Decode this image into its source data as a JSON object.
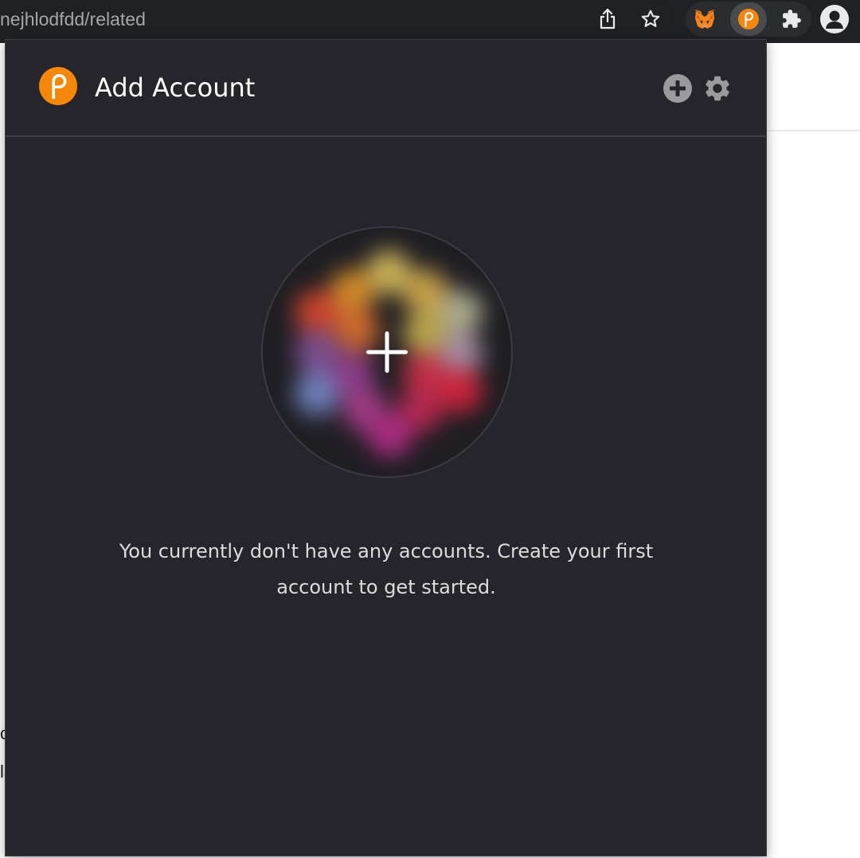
{
  "browser": {
    "url_fragment": "nejhlodfdd/related",
    "icons": {
      "share": "share-icon",
      "bookmark": "star-icon",
      "metamask": "metamask-fox-icon",
      "polkadot": "polkadot-extension-icon",
      "extensions": "puzzle-icon",
      "profile": "profile-avatar-icon"
    }
  },
  "page_behind": {
    "fragments": [
      "c",
      "la"
    ]
  },
  "popup": {
    "title": "Add Account",
    "header_icons": {
      "add": "add-circle-icon",
      "settings": "gear-icon"
    },
    "create_icon": "plus-icon",
    "empty_message": "You currently don't have any accounts. Create your first account to get started.",
    "colors": {
      "background": "#26252b",
      "accent": "#f5870a",
      "text": "#ffffff"
    }
  }
}
